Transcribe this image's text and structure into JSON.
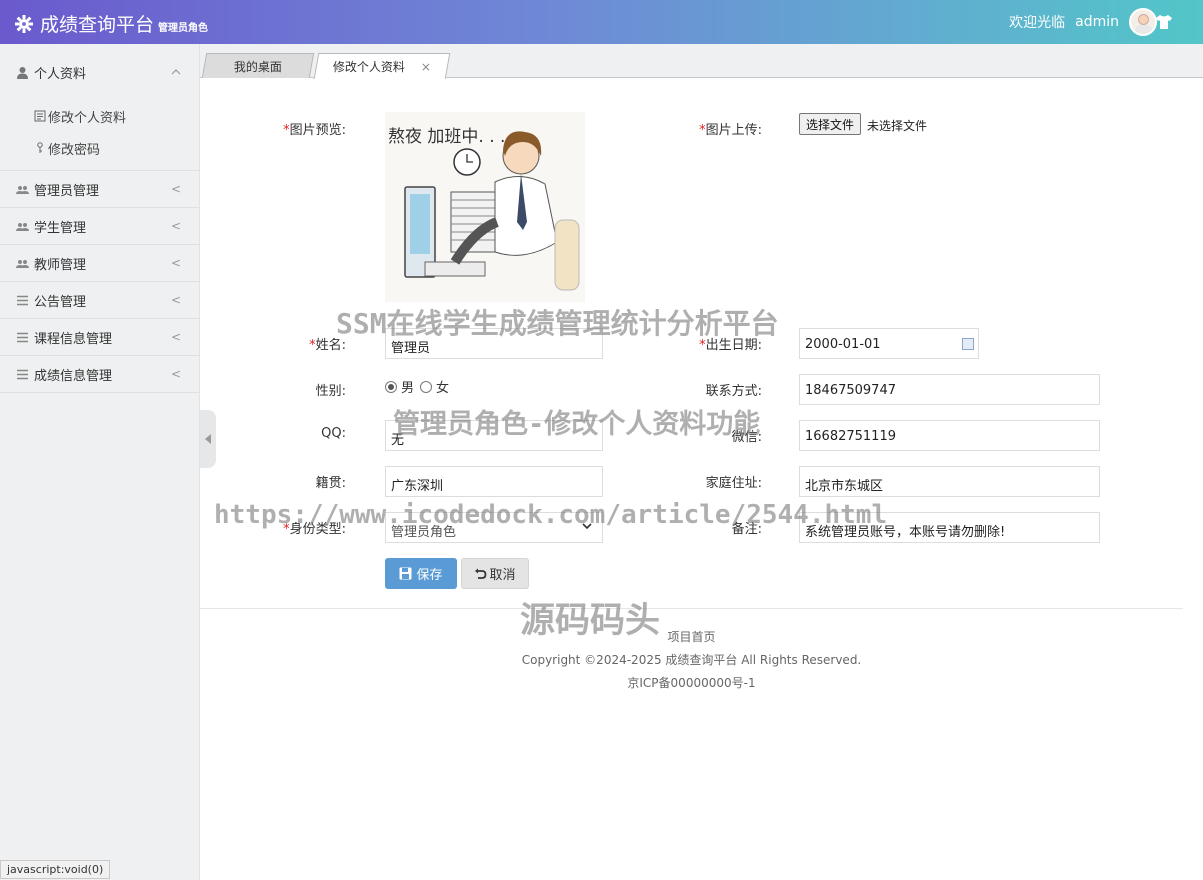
{
  "header": {
    "title": "成绩查询平台",
    "role": "管理员角色",
    "welcome": "欢迎光临",
    "username": "admin",
    "logo_icon": "gear-icon",
    "theme_icon": "tshirt-icon"
  },
  "sidebar": {
    "groups": [
      {
        "label": "个人资料",
        "icon": "user-icon",
        "expanded": true,
        "items": [
          {
            "label": "修改个人资料",
            "icon": "edit-icon"
          },
          {
            "label": "修改密码",
            "icon": "key-icon"
          }
        ]
      },
      {
        "label": "管理员管理",
        "icon": "users-icon"
      },
      {
        "label": "学生管理",
        "icon": "users-icon"
      },
      {
        "label": "教师管理",
        "icon": "users-icon"
      },
      {
        "label": "公告管理",
        "icon": "list-icon"
      },
      {
        "label": "课程信息管理",
        "icon": "list-icon"
      },
      {
        "label": "成绩信息管理",
        "icon": "list-icon"
      }
    ]
  },
  "tabs": [
    {
      "label": "我的桌面",
      "active": false
    },
    {
      "label": "修改个人资料",
      "active": true,
      "close": "×"
    }
  ],
  "form": {
    "preview_label": "图片预览:",
    "upload_label": "图片上传:",
    "file_button": "选择文件",
    "file_status": "未选择文件",
    "preview_text": "熬夜 加班中. . .",
    "name_label": "姓名:",
    "name_value": "管理员",
    "birth_label": "出生日期:",
    "birth_value": "2000-01-01",
    "gender_label": "性别:",
    "gender_male": "男",
    "gender_female": "女",
    "gender_selected": "男",
    "phone_label": "联系方式:",
    "phone_value": "18467509747",
    "qq_label": "QQ:",
    "qq_value": "无",
    "wechat_label": "微信:",
    "wechat_value": "16682751119",
    "hometown_label": "籍贯:",
    "hometown_value": "广东深圳",
    "address_label": "家庭住址:",
    "address_value": "北京市东城区",
    "identity_label": "身份类型:",
    "identity_value": "管理员角色",
    "remark_label": "备注:",
    "remark_value": "系统管理员账号，本账号请勿删除!",
    "required_mark": "*",
    "save_label": "保存",
    "cancel_label": "取消"
  },
  "footer": {
    "home_link": "项目首页",
    "copyright": "Copyright ©2024-2025 成绩查询平台 All Rights Reserved.",
    "icp": "京ICP备00000000号-1"
  },
  "watermarks": {
    "line1": "SSM在线学生成绩管理统计分析平台",
    "line2": "管理员角色-修改个人资料功能",
    "line3": "https://www.icodedock.com/article/2544.html",
    "line4": "源码码头"
  },
  "status_bar": "javascript:void(0)"
}
